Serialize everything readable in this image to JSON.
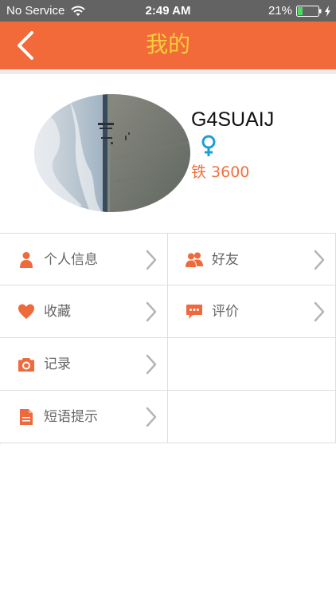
{
  "status_bar": {
    "carrier": "No Service",
    "time": "2:49 AM",
    "battery": "21%"
  },
  "nav": {
    "title": "我的",
    "back_icon": "chevron-left-icon"
  },
  "profile": {
    "username": "G4SUAIJ",
    "gender_icon": "female-symbol-icon",
    "score_label": "铁",
    "score_value": "3600"
  },
  "menu": {
    "items": [
      {
        "label": "个人信息",
        "icon": "person-icon"
      },
      {
        "label": "好友",
        "icon": "friends-icon"
      },
      {
        "label": "收藏",
        "icon": "heart-icon"
      },
      {
        "label": "评价",
        "icon": "chat-bubble-icon"
      },
      {
        "label": "记录",
        "icon": "camera-icon"
      },
      {
        "label": "短语提示",
        "icon": "document-icon"
      }
    ]
  },
  "colors": {
    "nav_background": "#f26a3a",
    "nav_title": "#f7ce3a",
    "accent": "#ee7140",
    "gender_icon": "#1b9fd8",
    "chevron": "#b5b5b5"
  }
}
